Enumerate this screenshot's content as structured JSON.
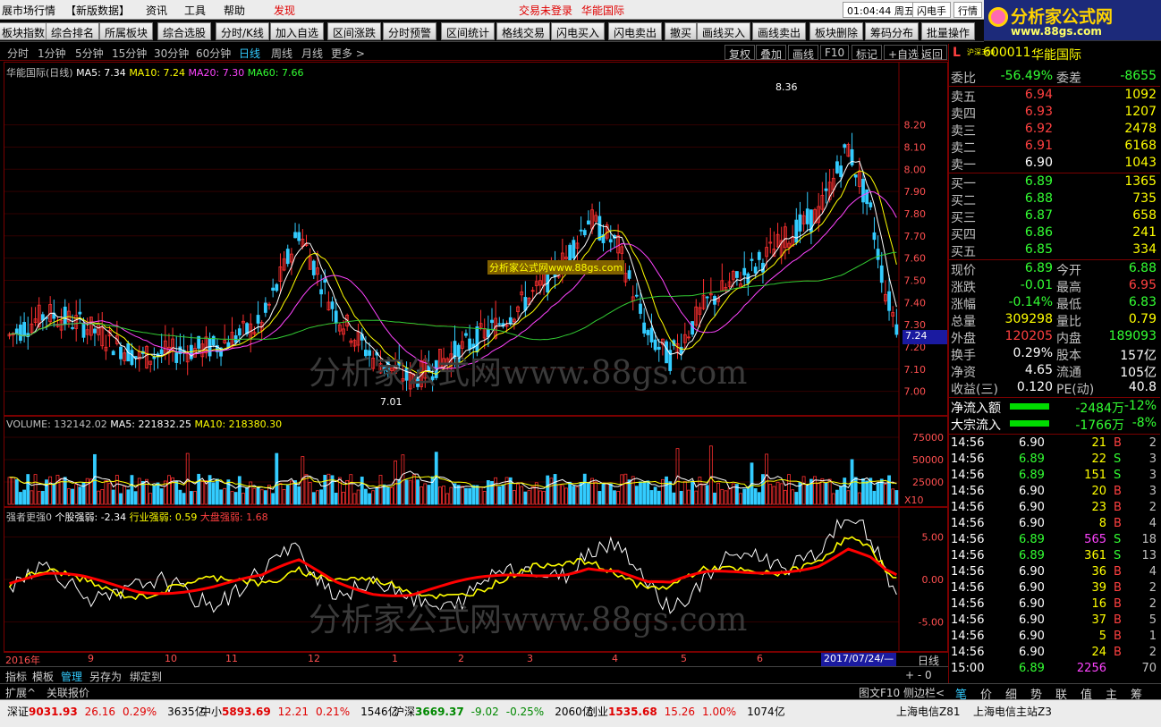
{
  "menubar": {
    "items": [
      "展市场行情",
      "【新版数据】",
      "资讯",
      "工具",
      "帮助"
    ],
    "discover": "发现",
    "login_status": "交易未登录",
    "broker": "华能国际",
    "time": "01:04:44",
    "weekday": "周五",
    "flash_trade": "闪电手",
    "quote_btn": "行情"
  },
  "logo": {
    "title": "分析家公式网",
    "url": "www.88gs.com"
  },
  "toolbar": [
    "板块指数",
    "综合排名",
    "所属板块",
    "综合选股",
    "分时/K线",
    "加入自选",
    "区间涨跌",
    "分时预警",
    "区间统计",
    "格线交易",
    "闪电买入",
    "闪电卖出",
    "撤买",
    "画线买入",
    "画线卖出",
    "板块删除",
    "筹码分布",
    "批量操作"
  ],
  "periods": [
    "分时",
    "1分钟",
    "5分钟",
    "15分钟",
    "30分钟",
    "60分钟",
    "日线",
    "周线",
    "月线",
    "更多 >"
  ],
  "active_period": "日线",
  "right_buttons": [
    "复权",
    "叠加",
    "画线",
    "F10",
    "标记",
    "+自选",
    "返回"
  ],
  "kline": {
    "title": "华能国际(日线)",
    "ma5": "MA5: 7.34",
    "ma10": "MA10: 7.24",
    "ma20": "MA20: 7.30",
    "ma60": "MA60: 7.66",
    "high_mark": "8.36",
    "low_mark": "7.01",
    "current_tag": "7.24",
    "y_ticks": [
      "8.20",
      "8.10",
      "8.00",
      "7.90",
      "7.80",
      "7.70",
      "7.60",
      "7.50",
      "7.40",
      "7.30",
      "7.20",
      "7.10",
      "7.00"
    ],
    "watermark": "分析家公式网www.88gs.com",
    "watermark_small": "分析家公式网www.88gs.com"
  },
  "volume": {
    "title": "VOLUME: 132142.02",
    "ma5": "MA5: 221832.25",
    "ma10": "MA10: 218380.30",
    "y_ticks": [
      "75000",
      "50000",
      "25000"
    ],
    "unit": "X10"
  },
  "indicator": {
    "title": "强者更强0",
    "stock": "个股强弱: -2.34",
    "sector": "行业强弱: 0.59",
    "market": "大盘强弱: 1.68",
    "y_ticks": [
      "5.00",
      "0.00",
      "-5.00"
    ],
    "watermark": "分析家公式网www.88gs.com"
  },
  "xaxis": {
    "labels": [
      "2016年",
      "9",
      "10",
      "11",
      "12",
      "1",
      "2",
      "3",
      "4",
      "5",
      "6"
    ],
    "cursor_date": "2017/07/24/—",
    "period_label": "日线"
  },
  "quote": {
    "index_tag": "L",
    "hs300": "沪深300",
    "code": "600011",
    "name": "华能国际",
    "weibi_label": "委比",
    "weibi": "-56.49%",
    "weicha_label": "委差",
    "weicha": "-8655",
    "asks": [
      {
        "label": "卖五",
        "price": "6.94",
        "vol": "1092"
      },
      {
        "label": "卖四",
        "price": "6.93",
        "vol": "1207"
      },
      {
        "label": "卖三",
        "price": "6.92",
        "vol": "2478"
      },
      {
        "label": "卖二",
        "price": "6.91",
        "vol": "6168"
      },
      {
        "label": "卖一",
        "price": "6.90",
        "vol": "1043"
      }
    ],
    "bids": [
      {
        "label": "买一",
        "price": "6.89",
        "vol": "1365"
      },
      {
        "label": "买二",
        "price": "6.88",
        "vol": "735"
      },
      {
        "label": "买三",
        "price": "6.87",
        "vol": "658"
      },
      {
        "label": "买四",
        "price": "6.86",
        "vol": "241"
      },
      {
        "label": "买五",
        "price": "6.85",
        "vol": "334"
      }
    ],
    "stats": [
      {
        "l1": "现价",
        "v1": "6.89",
        "c1": "green",
        "l2": "今开",
        "v2": "6.88",
        "c2": "green"
      },
      {
        "l1": "涨跌",
        "v1": "-0.01",
        "c1": "green",
        "l2": "最高",
        "v2": "6.95",
        "c2": "red"
      },
      {
        "l1": "涨幅",
        "v1": "-0.14%",
        "c1": "green",
        "l2": "最低",
        "v2": "6.83",
        "c2": "green"
      },
      {
        "l1": "总量",
        "v1": "309298",
        "c1": "yellow",
        "l2": "量比",
        "v2": "0.79",
        "c2": "yellow"
      },
      {
        "l1": "外盘",
        "v1": "120205",
        "c1": "red",
        "l2": "内盘",
        "v2": "189093",
        "c2": "green"
      },
      {
        "l1": "换手",
        "v1": "0.29%",
        "c1": "white",
        "l2": "股本",
        "v2": "157亿",
        "c2": "white"
      },
      {
        "l1": "净资",
        "v1": "4.65",
        "c1": "white",
        "l2": "流通",
        "v2": "105亿",
        "c2": "white"
      },
      {
        "l1": "收益(三)",
        "v1": "0.120",
        "c1": "white",
        "l2": "PE(动)",
        "v2": "40.8",
        "c2": "white"
      }
    ],
    "flow": [
      {
        "label": "净流入额",
        "amount": "-2484万",
        "pct": "-12%"
      },
      {
        "label": "大宗流入",
        "amount": "-1766万",
        "pct": "-8%"
      }
    ],
    "ticks": [
      {
        "t": "14:56",
        "p": "6.90",
        "pc": "white",
        "v": "21",
        "vc": "yellow",
        "bs": "B",
        "n": "2"
      },
      {
        "t": "14:56",
        "p": "6.89",
        "pc": "green",
        "v": "22",
        "vc": "yellow",
        "bs": "S",
        "n": "3"
      },
      {
        "t": "14:56",
        "p": "6.89",
        "pc": "green",
        "v": "151",
        "vc": "yellow",
        "bs": "S",
        "n": "3"
      },
      {
        "t": "14:56",
        "p": "6.90",
        "pc": "white",
        "v": "20",
        "vc": "yellow",
        "bs": "B",
        "n": "3"
      },
      {
        "t": "14:56",
        "p": "6.90",
        "pc": "white",
        "v": "23",
        "vc": "yellow",
        "bs": "B",
        "n": "2"
      },
      {
        "t": "14:56",
        "p": "6.90",
        "pc": "white",
        "v": "8",
        "vc": "yellow",
        "bs": "B",
        "n": "4"
      },
      {
        "t": "14:56",
        "p": "6.89",
        "pc": "green",
        "v": "565",
        "vc": "magenta",
        "bs": "S",
        "n": "18"
      },
      {
        "t": "14:56",
        "p": "6.89",
        "pc": "green",
        "v": "361",
        "vc": "yellow",
        "bs": "S",
        "n": "13"
      },
      {
        "t": "14:56",
        "p": "6.90",
        "pc": "white",
        "v": "36",
        "vc": "yellow",
        "bs": "B",
        "n": "4"
      },
      {
        "t": "14:56",
        "p": "6.90",
        "pc": "white",
        "v": "39",
        "vc": "yellow",
        "bs": "B",
        "n": "2"
      },
      {
        "t": "14:56",
        "p": "6.90",
        "pc": "white",
        "v": "16",
        "vc": "yellow",
        "bs": "B",
        "n": "2"
      },
      {
        "t": "14:56",
        "p": "6.90",
        "pc": "white",
        "v": "37",
        "vc": "yellow",
        "bs": "B",
        "n": "5"
      },
      {
        "t": "14:56",
        "p": "6.90",
        "pc": "white",
        "v": "5",
        "vc": "yellow",
        "bs": "B",
        "n": "1"
      },
      {
        "t": "14:56",
        "p": "6.90",
        "pc": "white",
        "v": "24",
        "vc": "yellow",
        "bs": "B",
        "n": "2"
      },
      {
        "t": "15:00",
        "p": "6.89",
        "pc": "green",
        "v": "2256",
        "vc": "magenta",
        "bs": "",
        "n": "70"
      }
    ]
  },
  "indicator_bar": [
    "指标",
    "模板",
    "管理",
    "另存为",
    "绑定到"
  ],
  "ext_bar": [
    "扩展^",
    "关联报价"
  ],
  "ext_right": [
    "图文F10",
    "侧边栏<"
  ],
  "quote_tabs": [
    "笔",
    "价",
    "细",
    "势",
    "联",
    "值",
    "主",
    "筹"
  ],
  "statusbar": {
    "items": [
      {
        "name": "深证",
        "val": "9031.93",
        "chg": "26.16",
        "pct": "0.29%",
        "amt": "3635亿",
        "color": "red"
      },
      {
        "name": "中小",
        "val": "5893.69",
        "chg": "12.21",
        "pct": "0.21%",
        "amt": "1546亿",
        "color": "red"
      },
      {
        "name": "沪深",
        "val": "3669.37",
        "chg": "-9.02",
        "pct": "-0.25%",
        "amt": "2060亿",
        "color": "green"
      },
      {
        "name": "创业",
        "val": "1535.68",
        "chg": "15.26",
        "pct": "1.00%",
        "amt": "1074亿",
        "color": "red"
      }
    ],
    "server1": "上海电信Z81",
    "server2": "上海电信主站Z3"
  },
  "colors": {
    "up": "#ff3030",
    "down": "#33ccff",
    "ma5": "#ffffff",
    "ma10": "#ffff00",
    "ma20": "#ff44ff",
    "ma60": "#33cc33",
    "stock_line": "#ffffff",
    "sector_line": "#ffff00",
    "market_line": "#ff0000"
  }
}
